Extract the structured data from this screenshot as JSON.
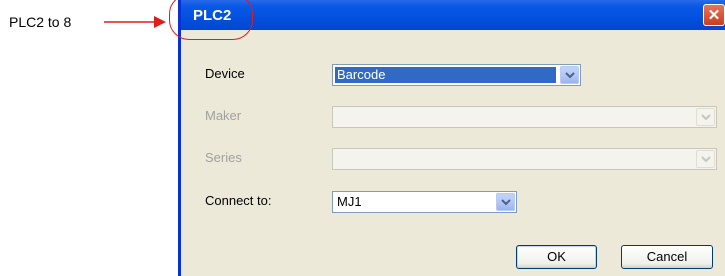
{
  "callout": {
    "text": "PLC2 to 8"
  },
  "window": {
    "title": "PLC2",
    "close_symbol": "✕"
  },
  "form": {
    "device": {
      "label": "Device",
      "value": "Barcode"
    },
    "maker": {
      "label": "Maker",
      "value": ""
    },
    "series": {
      "label": "Series",
      "value": ""
    },
    "connect_to": {
      "label": "Connect to:",
      "value": "MJ1"
    }
  },
  "buttons": {
    "ok": "OK",
    "cancel": "Cancel"
  },
  "colors": {
    "callout_red": "#e21b1b",
    "title_blue": "#0a58e6",
    "selection_blue": "#316ac5"
  }
}
